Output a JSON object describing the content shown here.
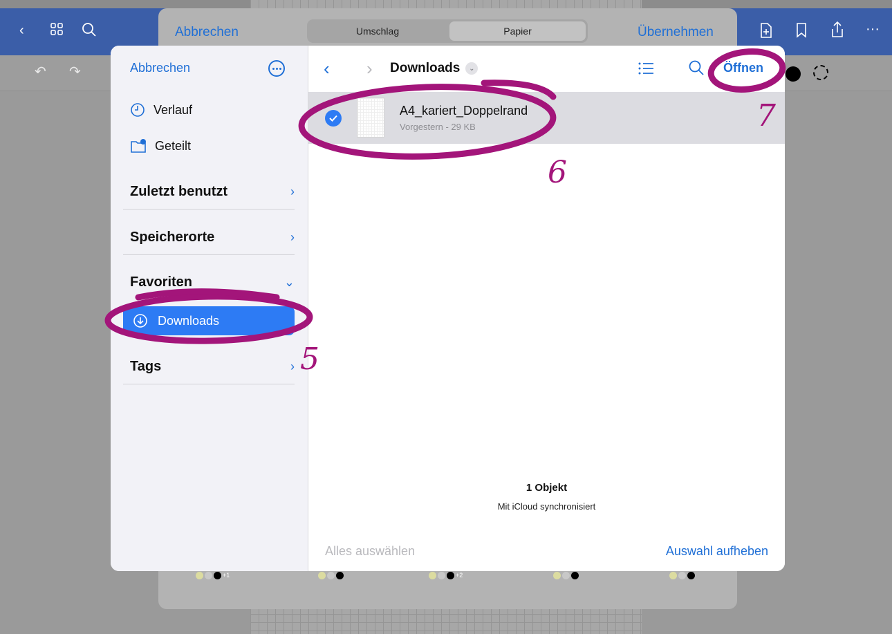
{
  "background_app": {
    "sheet": {
      "cancel_label": "Abbrechen",
      "apply_label": "Übernehmen",
      "segments": [
        "Umschlag",
        "Papier"
      ],
      "swatch_counts": [
        "+1",
        "+2"
      ]
    }
  },
  "sidebar": {
    "cancel_label": "Abbrechen",
    "rows": [
      {
        "label": "Verlauf",
        "icon": "clock-icon"
      },
      {
        "label": "Geteilt",
        "icon": "shared-folder-icon"
      }
    ],
    "sections": [
      {
        "label": "Zuletzt benutzt",
        "chevron": "›"
      },
      {
        "label": "Speicherorte",
        "chevron": "›"
      },
      {
        "label": "Favoriten",
        "chevron": "⌄"
      }
    ],
    "favorites_item": "Downloads",
    "tags_label": "Tags",
    "tags_chevron": "›"
  },
  "browser": {
    "back": "‹",
    "forward": "›",
    "title": "Downloads",
    "open_label": "Öffnen",
    "file": {
      "name": "A4_kariert_Doppelrand",
      "meta": "Vorgestern - 29 KB"
    },
    "summary_count": "1 Objekt",
    "summary_sync": "Mit iCloud synchronisiert",
    "select_all": "Alles auswählen",
    "deselect": "Auswahl aufheben"
  },
  "annotations": {
    "step_5": "5",
    "step_6": "6",
    "step_7": "7",
    "color": "#a3157a"
  },
  "colors": {
    "accent": "#1f6fd6",
    "selection": "#2d7bf4",
    "app_bar": "#3b5ea8"
  }
}
